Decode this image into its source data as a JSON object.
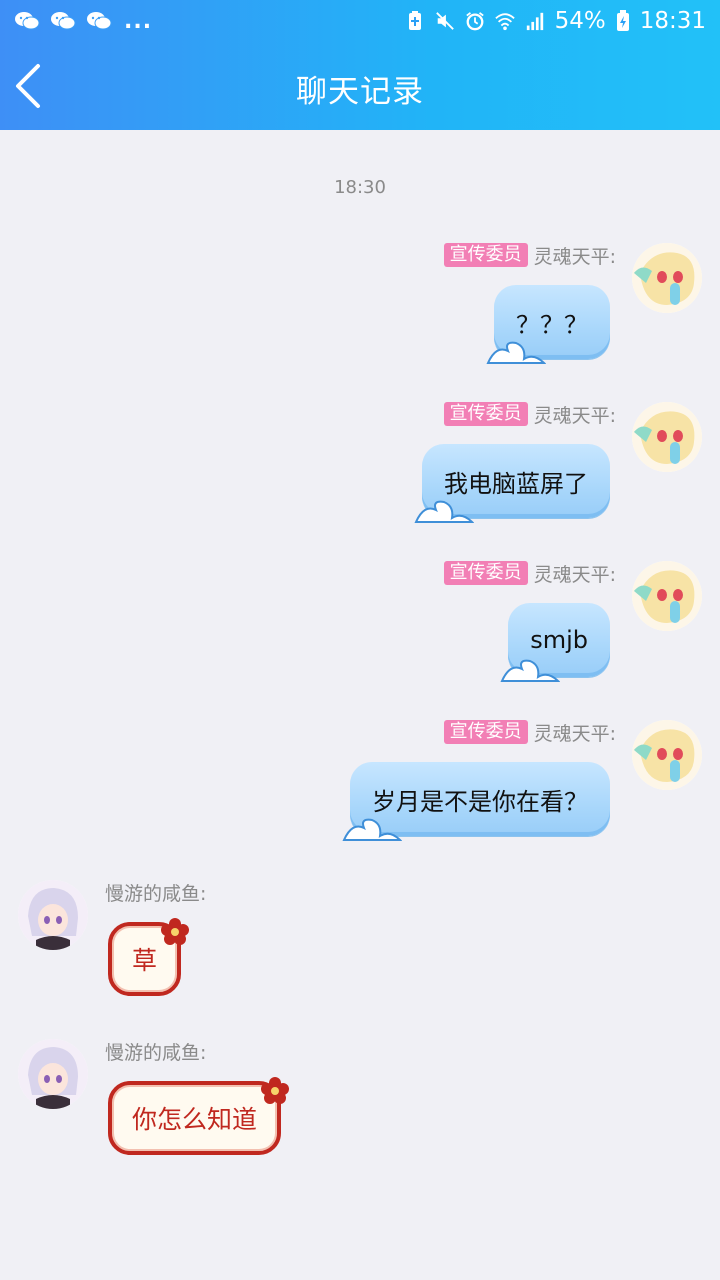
{
  "status_bar": {
    "notifications": [
      "wechat-icon",
      "wechat-icon",
      "wechat-icon"
    ],
    "more": "...",
    "battery": "54%",
    "time": "18:31"
  },
  "nav": {
    "title": "聊天记录"
  },
  "chat": {
    "time_divider": "18:30",
    "messages": [
      {
        "side": "right",
        "badge": "宣传委员",
        "sender": "灵魂天平:",
        "text": "？？？"
      },
      {
        "side": "right",
        "badge": "宣传委员",
        "sender": "灵魂天平:",
        "text": "我电脑蓝屏了"
      },
      {
        "side": "right",
        "badge": "宣传委员",
        "sender": "灵魂天平:",
        "text": "smjb"
      },
      {
        "side": "right",
        "badge": "宣传委员",
        "sender": "灵魂天平:",
        "text": "岁月是不是你在看？"
      },
      {
        "side": "left",
        "sender": "慢游的咸鱼:",
        "text": "草"
      },
      {
        "side": "left",
        "sender": "慢游的咸鱼:",
        "text": "你怎么知道"
      }
    ]
  }
}
